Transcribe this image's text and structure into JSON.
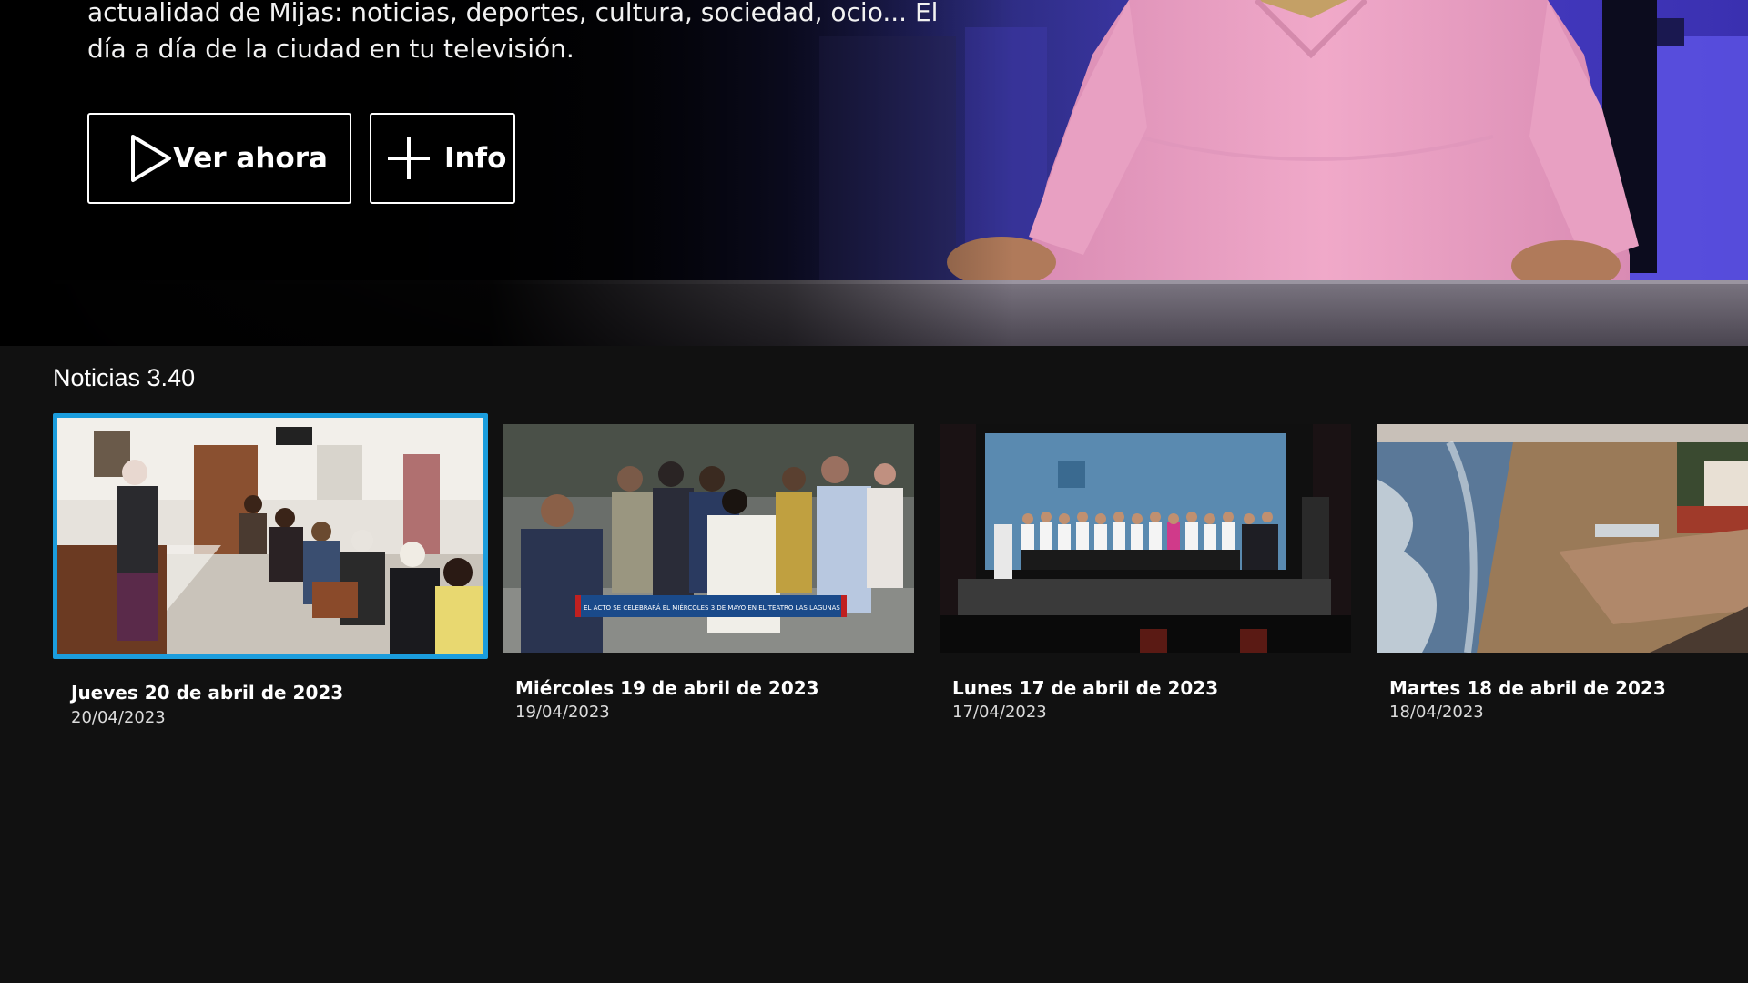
{
  "hero": {
    "description": "actualidad de Mijas: noticias, deportes, cultura, sociedad, ocio... El día a día de la ciudad en tu televisión.",
    "buttons": {
      "watch_label": "Ver ahora",
      "info_label": "Info"
    }
  },
  "row": {
    "title": "Noticias 3.40",
    "items": [
      {
        "title": "Jueves 20 de abril de 2023",
        "date": "20/04/2023"
      },
      {
        "title": "Miércoles 19 de abril de 2023",
        "date": "19/04/2023"
      },
      {
        "title": "Lunes 17 de abril de 2023",
        "date": "17/04/2023"
      },
      {
        "title": "Martes 18 de abril de 2023",
        "date": "18/04/2023"
      }
    ],
    "thumb_caption_2": "EL ACTO SE CELEBRARÁ EL MIÉRCOLES 3 DE MAYO EN EL TEATRO LAS LAGUNAS"
  },
  "colors": {
    "background": "#111111",
    "focus_border": "#1b9ddd",
    "button_border": "#ffffff"
  },
  "icons": {
    "watch_button": "play-icon",
    "info_button": "plus-icon"
  }
}
